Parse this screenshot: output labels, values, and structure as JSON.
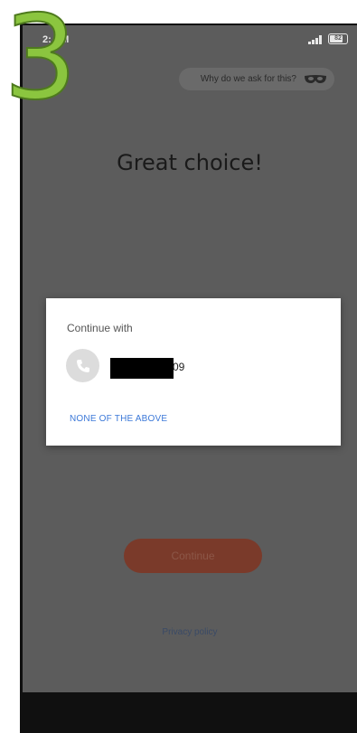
{
  "annotation": {
    "step_number": "3",
    "color": "#8bc53f"
  },
  "status_bar": {
    "time": "2:  PM",
    "battery": "82"
  },
  "header": {
    "why_label": "Why do we ask for this?",
    "mask_icon": "mask-icon",
    "back_icon": "back-arrow-icon"
  },
  "main": {
    "headline": "Great choice!",
    "continue_label": "Continue",
    "privacy_label": "Privacy policy"
  },
  "dialog": {
    "title": "Continue with",
    "phone_suffix": "09",
    "none_label": "NONE OF THE ABOVE",
    "accent_color": "#3b78d8"
  },
  "nav_bar": {
    "recent_icon": "square-icon",
    "home_icon": "circle-icon",
    "back_icon": "triangle-back-icon"
  }
}
